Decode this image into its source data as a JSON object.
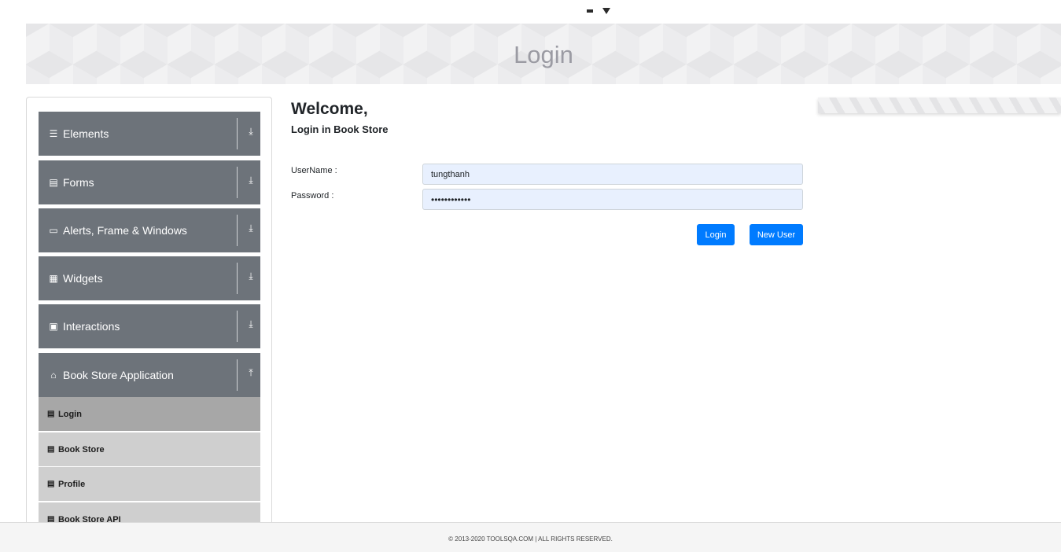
{
  "header": {
    "title": "Login"
  },
  "sidebar": {
    "groups": [
      {
        "label": "Elements",
        "icon": "hamburger-icon",
        "glyph": "☰",
        "arrow": "⤓"
      },
      {
        "label": "Forms",
        "icon": "form-icon",
        "glyph": "▤",
        "arrow": "⤓"
      },
      {
        "label": "Alerts, Frame & Windows",
        "icon": "window-icon",
        "glyph": "▭",
        "arrow": "⤓"
      },
      {
        "label": "Widgets",
        "icon": "widgets-icon",
        "glyph": "▦",
        "arrow": "⤓"
      },
      {
        "label": "Interactions",
        "icon": "interactions-icon",
        "glyph": "▣",
        "arrow": "⤓"
      },
      {
        "label": "Book Store Application",
        "icon": "book-store-icon",
        "glyph": "⌂",
        "arrow": "⤒"
      }
    ],
    "book_store_items": [
      {
        "label": "Login",
        "active": true
      },
      {
        "label": "Book Store",
        "active": false
      },
      {
        "label": "Profile",
        "active": false
      },
      {
        "label": "Book Store API",
        "active": false
      }
    ]
  },
  "main": {
    "welcome": "Welcome,",
    "subtitle": "Login in Book Store",
    "username_label": "UserName :",
    "username_value": "tungthanh",
    "password_label": "Password :",
    "password_value": "••••••••••••",
    "login_button": "Login",
    "new_user_button": "New User"
  },
  "footer": {
    "text": "© 2013-2020 TOOLSQA.COM | ALL RIGHTS RESERVED."
  },
  "colors": {
    "accent": "#007bff",
    "sidebar_header": "#6d737a",
    "sub_item": "#cfcfcf",
    "sub_item_active": "#a7a7a7",
    "input_bg": "#e8f0fe"
  }
}
